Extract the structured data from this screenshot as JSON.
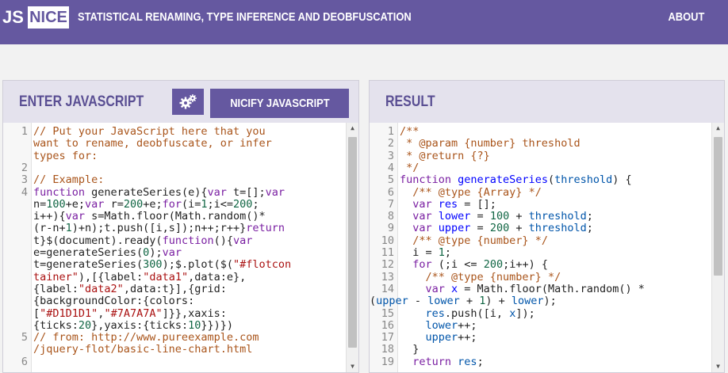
{
  "header": {
    "logo_left": "JS",
    "logo_right": "NICE",
    "tagline": "STATISTICAL RENAMING, TYPE INFERENCE AND DEOBFUSCATION",
    "about_label": "ABOUT"
  },
  "left_panel": {
    "title": "ENTER JAVASCRIPT",
    "settings_icon": "gears-icon",
    "nicify_label": "NICIFY JAVASCRIPT",
    "lines": [
      {
        "n": "1",
        "parts": [
          [
            "cm",
            "// Put your JavaScript here that you"
          ]
        ]
      },
      {
        "n": "",
        "parts": [
          [
            "cm",
            "want to rename, deobfuscate, or infer"
          ]
        ]
      },
      {
        "n": "",
        "parts": [
          [
            "cm",
            "types for:"
          ]
        ]
      },
      {
        "n": "2",
        "parts": []
      },
      {
        "n": "3",
        "parts": [
          [
            "cm",
            "// Example:"
          ]
        ]
      },
      {
        "n": "4",
        "parts": [
          [
            "kw",
            "function "
          ],
          [
            "plain",
            "generateSeries(e){"
          ],
          [
            "kw",
            "var "
          ],
          [
            "plain",
            "t=[];"
          ],
          [
            "kw",
            "var"
          ]
        ]
      },
      {
        "n": "",
        "parts": [
          [
            "plain",
            "n="
          ],
          [
            "num",
            "100"
          ],
          [
            "plain",
            "+e;"
          ],
          [
            "kw",
            "var "
          ],
          [
            "plain",
            "r="
          ],
          [
            "num",
            "200"
          ],
          [
            "plain",
            "+e;"
          ],
          [
            "kw",
            "for"
          ],
          [
            "plain",
            "(i="
          ],
          [
            "num",
            "1"
          ],
          [
            "plain",
            ";i<="
          ],
          [
            "num",
            "200"
          ],
          [
            "plain",
            ";"
          ]
        ]
      },
      {
        "n": "",
        "parts": [
          [
            "plain",
            "i++){"
          ],
          [
            "kw",
            "var "
          ],
          [
            "plain",
            "s=Math.floor(Math.random()*"
          ]
        ]
      },
      {
        "n": "",
        "parts": [
          [
            "plain",
            "(r-n+"
          ],
          [
            "num",
            "1"
          ],
          [
            "plain",
            ")+n);t.push([i,s]);n++;r++}"
          ],
          [
            "kw",
            "return"
          ]
        ]
      },
      {
        "n": "",
        "parts": [
          [
            "plain",
            "t}$(document).ready("
          ],
          [
            "kw",
            "function"
          ],
          [
            "plain",
            "(){"
          ],
          [
            "kw",
            "var"
          ]
        ]
      },
      {
        "n": "",
        "parts": [
          [
            "plain",
            "e=generateSeries("
          ],
          [
            "num",
            "0"
          ],
          [
            "plain",
            ");"
          ],
          [
            "kw",
            "var"
          ]
        ]
      },
      {
        "n": "",
        "parts": [
          [
            "plain",
            "t=generateSeries("
          ],
          [
            "num",
            "300"
          ],
          [
            "plain",
            ");$.plot($("
          ],
          [
            "str",
            "\"#flotcon"
          ]
        ]
      },
      {
        "n": "",
        "parts": [
          [
            "str",
            "tainer\""
          ],
          [
            "plain",
            "),[{label:"
          ],
          [
            "str",
            "\"data1\""
          ],
          [
            "plain",
            ",data:e},"
          ]
        ]
      },
      {
        "n": "",
        "parts": [
          [
            "plain",
            "{label:"
          ],
          [
            "str",
            "\"data2\""
          ],
          [
            "plain",
            ",data:t}],{grid:"
          ]
        ]
      },
      {
        "n": "",
        "parts": [
          [
            "plain",
            "{backgroundColor:{colors:"
          ]
        ]
      },
      {
        "n": "",
        "parts": [
          [
            "plain",
            "["
          ],
          [
            "str",
            "\"#D1D1D1\""
          ],
          [
            "plain",
            ","
          ],
          [
            "str",
            "\"#7A7A7A\""
          ],
          [
            "plain",
            "]}},xaxis:"
          ]
        ]
      },
      {
        "n": "",
        "parts": [
          [
            "plain",
            "{ticks:"
          ],
          [
            "num",
            "20"
          ],
          [
            "plain",
            "},yaxis:{ticks:"
          ],
          [
            "num",
            "10"
          ],
          [
            "plain",
            "}})})"
          ]
        ]
      },
      {
        "n": "5",
        "parts": [
          [
            "cm",
            "// from: http://www.pureexample.com"
          ]
        ]
      },
      {
        "n": "",
        "parts": [
          [
            "cm",
            "/jquery-flot/basic-line-chart.html"
          ]
        ]
      },
      {
        "n": "6",
        "parts": []
      }
    ]
  },
  "right_panel": {
    "title": "RESULT",
    "lines": [
      {
        "n": "1",
        "parts": [
          [
            "cm",
            "/**"
          ]
        ]
      },
      {
        "n": "2",
        "parts": [
          [
            "cm",
            " * @param {number} threshold"
          ]
        ]
      },
      {
        "n": "3",
        "parts": [
          [
            "cm",
            " * @return {?}"
          ]
        ]
      },
      {
        "n": "4",
        "parts": [
          [
            "cm",
            " */"
          ]
        ]
      },
      {
        "n": "5",
        "parts": [
          [
            "kw",
            "function "
          ],
          [
            "def",
            "generateSeries"
          ],
          [
            "plain",
            "("
          ],
          [
            "var",
            "threshold"
          ],
          [
            "plain",
            ") {"
          ]
        ]
      },
      {
        "n": "6",
        "parts": [
          [
            "plain",
            "  "
          ],
          [
            "cm",
            "/** @type {Array} */"
          ]
        ]
      },
      {
        "n": "7",
        "parts": [
          [
            "plain",
            "  "
          ],
          [
            "kw",
            "var "
          ],
          [
            "def",
            "res"
          ],
          [
            "plain",
            " = [];"
          ]
        ]
      },
      {
        "n": "8",
        "parts": [
          [
            "plain",
            "  "
          ],
          [
            "kw",
            "var "
          ],
          [
            "def",
            "lower"
          ],
          [
            "plain",
            " = "
          ],
          [
            "num",
            "100"
          ],
          [
            "plain",
            " + "
          ],
          [
            "var",
            "threshold"
          ],
          [
            "plain",
            ";"
          ]
        ]
      },
      {
        "n": "9",
        "parts": [
          [
            "plain",
            "  "
          ],
          [
            "kw",
            "var "
          ],
          [
            "def",
            "upper"
          ],
          [
            "plain",
            " = "
          ],
          [
            "num",
            "200"
          ],
          [
            "plain",
            " + "
          ],
          [
            "var",
            "threshold"
          ],
          [
            "plain",
            ";"
          ]
        ]
      },
      {
        "n": "10",
        "parts": [
          [
            "plain",
            "  "
          ],
          [
            "cm",
            "/** @type {number} */"
          ]
        ]
      },
      {
        "n": "11",
        "parts": [
          [
            "plain",
            "  i = "
          ],
          [
            "num",
            "1"
          ],
          [
            "plain",
            ";"
          ]
        ]
      },
      {
        "n": "12",
        "parts": [
          [
            "plain",
            "  "
          ],
          [
            "kw",
            "for "
          ],
          [
            "plain",
            "(;i <= "
          ],
          [
            "num",
            "200"
          ],
          [
            "plain",
            ";i++) {"
          ]
        ]
      },
      {
        "n": "13",
        "parts": [
          [
            "plain",
            "    "
          ],
          [
            "cm",
            "/** @type {number} */"
          ]
        ]
      },
      {
        "n": "14",
        "parts": [
          [
            "plain",
            "    "
          ],
          [
            "kw",
            "var "
          ],
          [
            "def",
            "x"
          ],
          [
            "plain",
            " = Math.floor(Math.random() *"
          ]
        ]
      },
      {
        "n": "",
        "parts": [
          [
            "plain",
            "("
          ],
          [
            "var",
            "upper"
          ],
          [
            "plain",
            " - "
          ],
          [
            "var",
            "lower"
          ],
          [
            "plain",
            " + "
          ],
          [
            "num",
            "1"
          ],
          [
            "plain",
            ") + "
          ],
          [
            "var",
            "lower"
          ],
          [
            "plain",
            ");"
          ]
        ],
        "wrap": true
      },
      {
        "n": "15",
        "parts": [
          [
            "plain",
            "    "
          ],
          [
            "var",
            "res"
          ],
          [
            "plain",
            ".push([i, "
          ],
          [
            "var",
            "x"
          ],
          [
            "plain",
            "]);"
          ]
        ]
      },
      {
        "n": "16",
        "parts": [
          [
            "plain",
            "    "
          ],
          [
            "var",
            "lower"
          ],
          [
            "plain",
            "++;"
          ]
        ]
      },
      {
        "n": "17",
        "parts": [
          [
            "plain",
            "    "
          ],
          [
            "var",
            "upper"
          ],
          [
            "plain",
            "++;"
          ]
        ]
      },
      {
        "n": "18",
        "parts": [
          [
            "plain",
            "  }"
          ]
        ]
      },
      {
        "n": "19",
        "parts": [
          [
            "plain",
            "  "
          ],
          [
            "kw",
            "return "
          ],
          [
            "var",
            "res"
          ],
          [
            "plain",
            ";"
          ]
        ]
      }
    ]
  }
}
